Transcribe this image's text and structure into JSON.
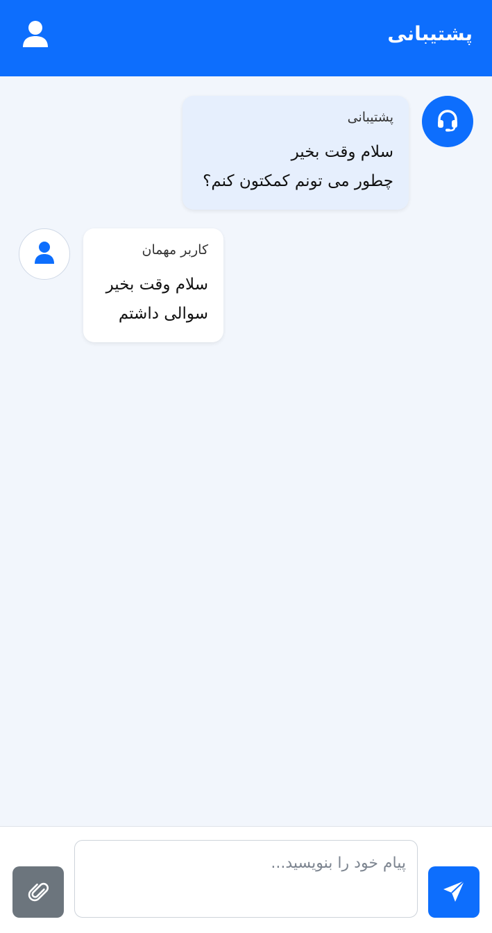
{
  "header": {
    "title": "پشتیبانی",
    "user_icon": "user-icon"
  },
  "messages": [
    {
      "role": "support",
      "sender": "پشتیبانی",
      "lines": [
        "سلام وقت بخیر",
        "چطور می تونم کمکتون کنم؟"
      ],
      "avatar_icon": "headset-icon"
    },
    {
      "role": "guest",
      "sender": "کاربر مهمان",
      "lines": [
        "سلام وقت بخیر",
        "سوالی داشتم"
      ],
      "avatar_icon": "user-icon"
    }
  ],
  "composer": {
    "placeholder": "پیام خود را بنویسید...",
    "value": "",
    "attach_icon": "paperclip-icon",
    "send_icon": "send-icon"
  },
  "colors": {
    "primary": "#0d6efd",
    "background": "#f2f6fc",
    "support_bubble": "#e6effd",
    "guest_bubble": "#ffffff",
    "attach_button": "#6c757d"
  }
}
